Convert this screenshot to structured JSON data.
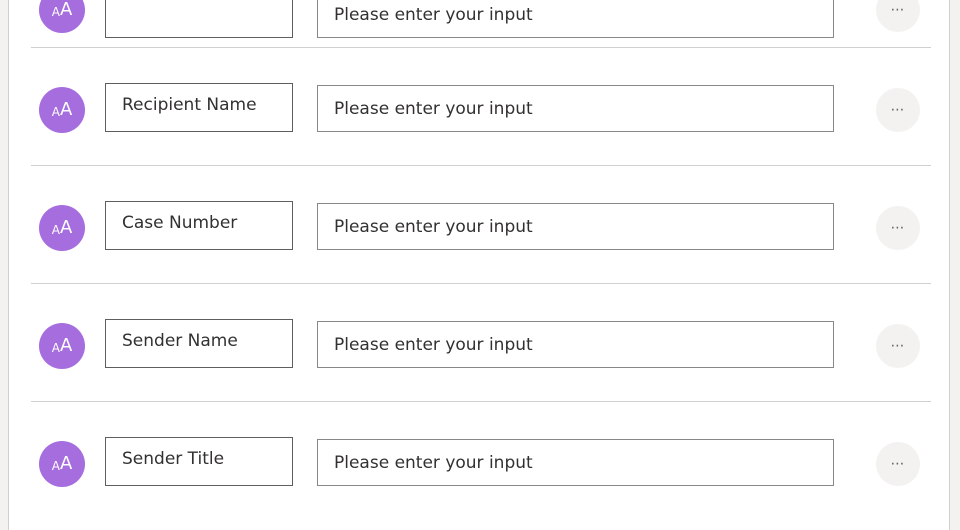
{
  "rows": [
    {
      "label": "",
      "value": "",
      "placeholder": "Please enter your input"
    },
    {
      "label": "Recipient Name",
      "value": "",
      "placeholder": "Please enter your input"
    },
    {
      "label": "Case Number",
      "value": "",
      "placeholder": "Please enter your input"
    },
    {
      "label": "Sender Name",
      "value": "",
      "placeholder": "Please enter your input"
    },
    {
      "label": "Sender Title",
      "value": "",
      "placeholder": "Please enter your input"
    }
  ],
  "avatar": {
    "icon": "text-font-size-icon",
    "small": "A",
    "big": "A",
    "color": "#a66ddf"
  },
  "more_button": {
    "icon": "more-horizontal-icon",
    "glyph": "⋯"
  }
}
